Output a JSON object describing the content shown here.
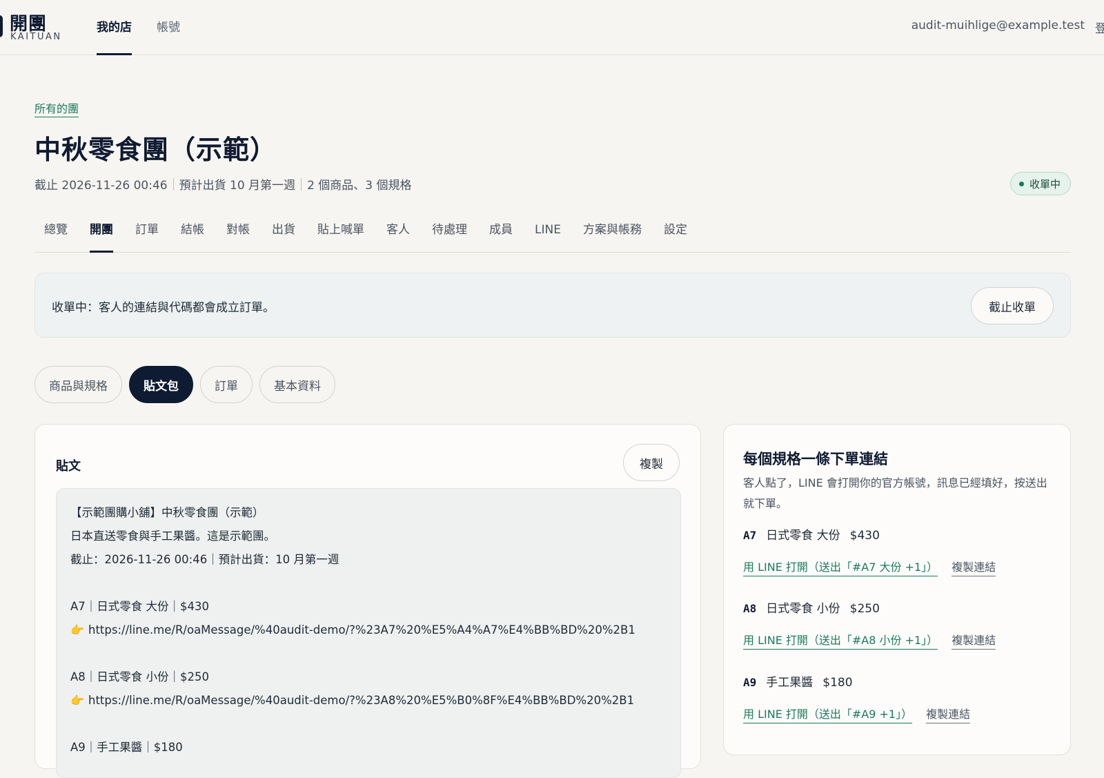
{
  "brand": {
    "title": "開團",
    "subtitle": "KAITUAN"
  },
  "topnav": [
    {
      "label": "我的店",
      "active": true
    },
    {
      "label": "帳號",
      "active": false
    }
  ],
  "user": {
    "email": "audit-muihlige@example.test",
    "cut_text": "登"
  },
  "breadcrumb": "所有的團",
  "page": {
    "title": "中秋零食團（示範）",
    "meta_deadline": "截止 2026-11-26 00:46",
    "meta_ship": "預計出貨 10 月第一週",
    "meta_count": "2 個商品、3 個規格",
    "status": "收單中"
  },
  "tabs": [
    "總覽",
    "開團",
    "訂單",
    "結帳",
    "對帳",
    "出貨",
    "貼上喊單",
    "客人",
    "待處理",
    "成員",
    "LINE",
    "方案與帳務",
    "設定"
  ],
  "active_tab": 1,
  "notice": {
    "text": "收單中：客人的連結與代碼都會成立訂單。",
    "button": "截止收單"
  },
  "subtabs": [
    "商品與規格",
    "貼文包",
    "訂單",
    "基本資料"
  ],
  "active_subtab": 1,
  "post": {
    "heading": "貼文",
    "copy_button": "複製",
    "line1": "【示範團購小舖】中秋零食團（示範）",
    "line2": "日本直送零食與手工果醬。這是示範團。",
    "line3": "截止：2026-11-26 00:46｜預計出貨：10 月第一週",
    "item1": "A7｜日式零食 大份｜$430",
    "url1": "https://line.me/R/oaMessage/%40audit-demo/?%23A7%20%E5%A4%A7%E4%BB%BD%20%2B1",
    "item2": "A8｜日式零食 小份｜$250",
    "url2": "https://line.me/R/oaMessage/%40audit-demo/?%23A8%20%E5%B0%8F%E4%BB%BD%20%2B1",
    "item3": "A9｜手工果醬｜$180",
    "hand_icon": "👉"
  },
  "links": {
    "heading": "每個規格一條下單連結",
    "desc": "客人點了，LINE 會打開你的官方帳號，訊息已經填好，按送出就下單。",
    "variants": [
      {
        "code": "A7",
        "name": "日式零食 大份",
        "price": "$430",
        "open": "用 LINE 打開（送出「#A7 大份 +1」）",
        "copy": "複製連結"
      },
      {
        "code": "A8",
        "name": "日式零食 小份",
        "price": "$250",
        "open": "用 LINE 打開（送出「#A8 小份 +1」）",
        "copy": "複製連結"
      },
      {
        "code": "A9",
        "name": "手工果醬",
        "price": "$180",
        "open": "用 LINE 打開（送出「#A9 +1」）",
        "copy": "複製連結"
      }
    ]
  }
}
